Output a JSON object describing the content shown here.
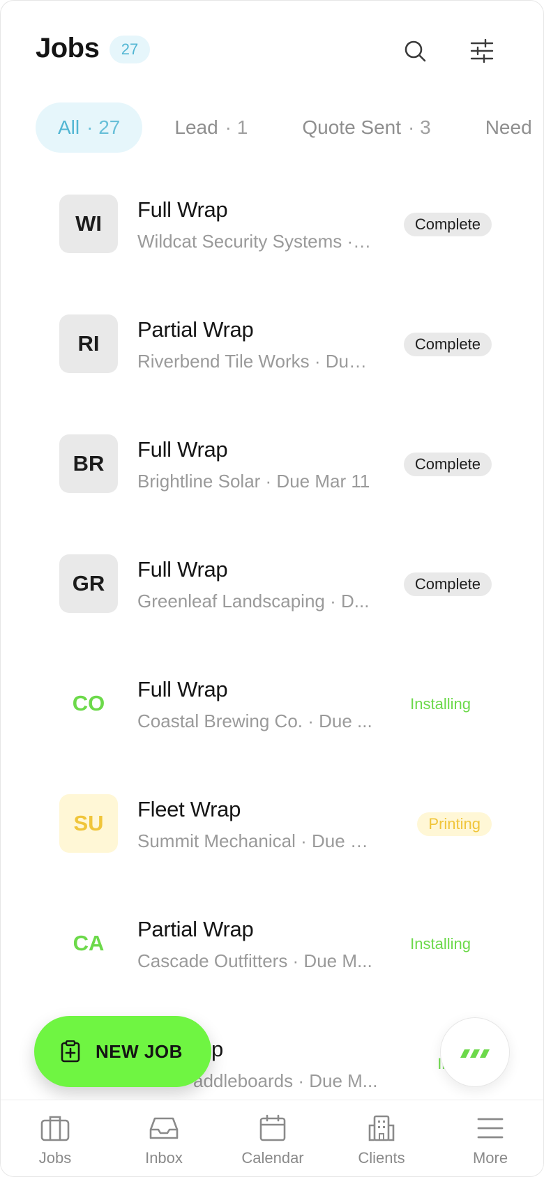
{
  "header": {
    "title": "Jobs",
    "count": "27",
    "search_icon": "search-icon",
    "filter_icon": "sliders-icon"
  },
  "tabs": [
    {
      "label": "All",
      "count": "· 27",
      "active": true
    },
    {
      "label": "Lead",
      "count": "· 1",
      "active": false
    },
    {
      "label": "Quote Sent",
      "count": "· 3",
      "active": false
    },
    {
      "label": "Need",
      "count": "",
      "active": false
    }
  ],
  "jobs": [
    {
      "initials": "WI",
      "title": "Full Wrap",
      "subtitle": "Wildcat Security Systems · Due ...",
      "status": "Complete"
    },
    {
      "initials": "RI",
      "title": "Partial Wrap",
      "subtitle": "Riverbend Tile Works · Due ...",
      "status": "Complete"
    },
    {
      "initials": "BR",
      "title": "Full Wrap",
      "subtitle": "Brightline Solar · Due Mar 11",
      "status": "Complete"
    },
    {
      "initials": "GR",
      "title": "Full Wrap",
      "subtitle": "Greenleaf Landscaping · D...",
      "status": "Complete"
    },
    {
      "initials": "CO",
      "title": "Full Wrap",
      "subtitle": "Coastal Brewing Co. · Due ...",
      "status": "Installing"
    },
    {
      "initials": "SU",
      "title": "Fleet Wrap",
      "subtitle": "Summit Mechanical · Due Ma...",
      "status": "Printing"
    },
    {
      "initials": "CA",
      "title": "Partial Wrap",
      "subtitle": "Cascade Outfitters · Due M...",
      "status": "Installing"
    },
    {
      "initials": "",
      "title": "p",
      "subtitle": "addleboards · Due M...",
      "status": "Insta"
    }
  ],
  "fab": {
    "label": "NEW JOB",
    "icon": "clipboard-plus-icon"
  },
  "nav": [
    {
      "label": "Jobs",
      "icon": "briefcase-icon"
    },
    {
      "label": "Inbox",
      "icon": "inbox-icon"
    },
    {
      "label": "Calendar",
      "icon": "calendar-icon"
    },
    {
      "label": "Clients",
      "icon": "building-icon"
    },
    {
      "label": "More",
      "icon": "menu-icon"
    }
  ],
  "colors": {
    "accent_blue": "#52b6d3",
    "accent_green": "#6ff542",
    "installing_green": "#6cd94a",
    "printing_yellow": "#f0c53a"
  }
}
